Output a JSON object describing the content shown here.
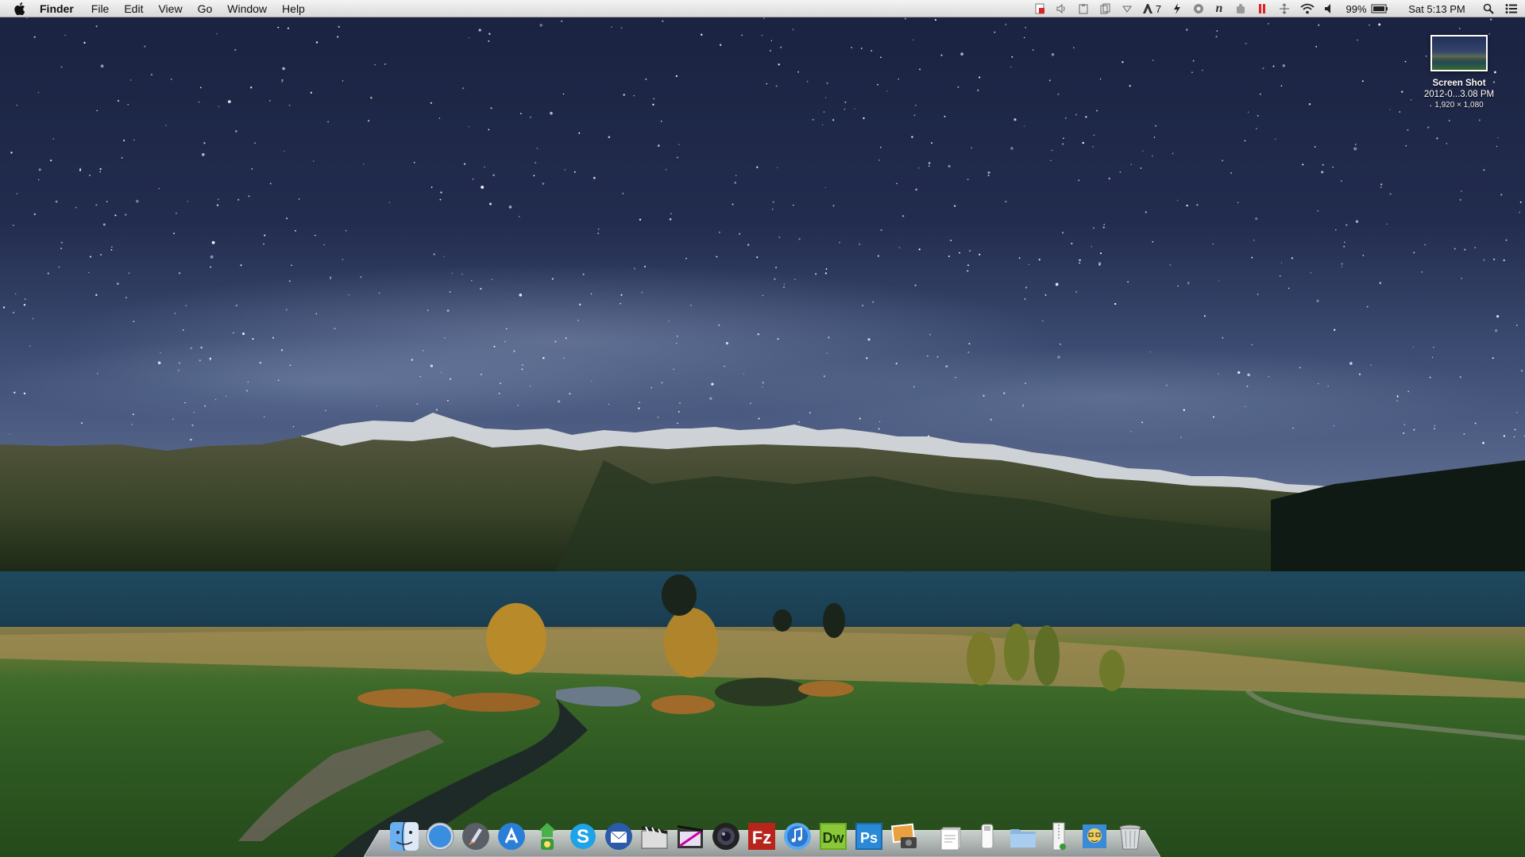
{
  "menubar": {
    "app_name": "Finder",
    "menus": [
      "File",
      "Edit",
      "View",
      "Go",
      "Window",
      "Help"
    ],
    "status": {
      "adobe_count": "7",
      "battery_percent": "99%",
      "clock": "Sat 5:13 PM"
    }
  },
  "desktop": {
    "icons": [
      {
        "name_line1": "Screen Shot",
        "name_line2": "2012-0...3.08 PM",
        "dimensions": "1,920 × 1,080"
      }
    ]
  },
  "dock": {
    "apps": [
      {
        "icon": "finder-icon"
      },
      {
        "icon": "safari-icon"
      },
      {
        "icon": "launchpad-icon"
      },
      {
        "icon": "app-store-icon"
      },
      {
        "icon": "cyberduck-icon"
      },
      {
        "icon": "skype-icon"
      },
      {
        "icon": "thunderbird-icon"
      },
      {
        "icon": "clapboard-icon"
      },
      {
        "icon": "final-cut-icon"
      },
      {
        "icon": "aperture-icon"
      },
      {
        "icon": "filezilla-icon"
      },
      {
        "icon": "itunes-icon"
      },
      {
        "icon": "dreamweaver-icon"
      },
      {
        "icon": "photoshop-icon"
      },
      {
        "icon": "iphoto-icon"
      }
    ],
    "app_labels": {
      "filezilla": "Fz",
      "dreamweaver": "Dw",
      "photoshop": "Ps"
    },
    "others": [
      {
        "icon": "document-stack-icon"
      },
      {
        "icon": "usb-drive-icon"
      },
      {
        "icon": "folder-stack-icon"
      },
      {
        "icon": "zip-stack-icon"
      },
      {
        "icon": "avatar-stack-icon"
      },
      {
        "icon": "trash-icon"
      }
    ]
  }
}
